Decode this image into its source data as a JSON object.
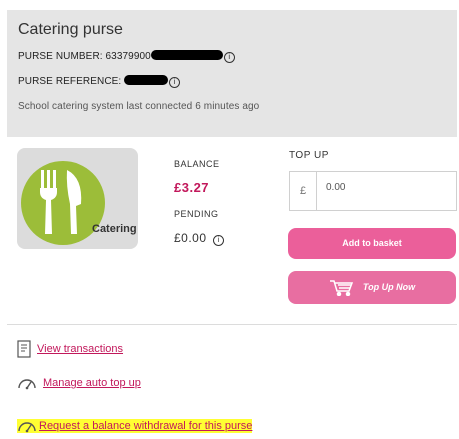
{
  "purse": {
    "title": "Catering purse",
    "number_label": "PURSE NUMBER: 63379900",
    "reference_label": "PURSE REFERENCE:",
    "status": "School catering system last connected 6 minutes ago"
  },
  "tile": {
    "label": "Catering",
    "icon": "fork-knife-icon"
  },
  "balance": {
    "label": "BALANCE",
    "value": "£3.27",
    "pending_label": "PENDING",
    "pending_value": "£0.00"
  },
  "topup": {
    "label": "TOP UP",
    "currency": "£",
    "amount": "0.00",
    "add_button": "Add to basket",
    "topup_button": "Top Up Now"
  },
  "links": {
    "transactions": "View transactions",
    "auto_topup": "Manage auto top up",
    "withdrawal": "Request a balance withdrawal for this purse"
  },
  "colors": {
    "accent_pink": "#eb5f9a",
    "balance_text": "#c2185b",
    "catering_green": "#9cbd39",
    "highlight": "#ffff33"
  }
}
